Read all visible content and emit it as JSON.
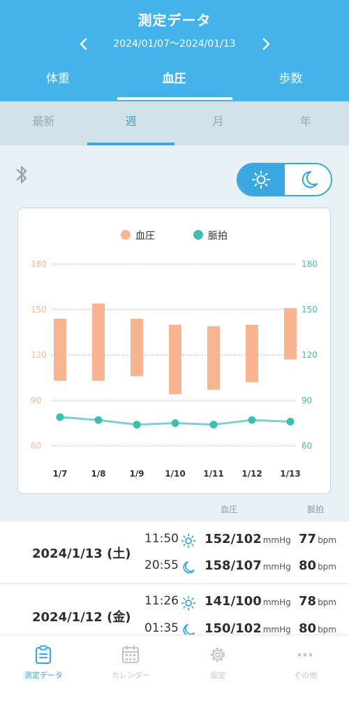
{
  "header": {
    "title": "測定データ",
    "date_range": "2024/01/07〜2024/01/13"
  },
  "tabs": [
    {
      "label": "体重"
    },
    {
      "label": "血圧"
    },
    {
      "label": "歩数"
    }
  ],
  "periods": [
    {
      "label": "最新"
    },
    {
      "label": "週"
    },
    {
      "label": "月"
    },
    {
      "label": "年"
    }
  ],
  "colors": {
    "accent": "#43b3e9",
    "bp": "#f9b592",
    "pulse": "#3fbdb0"
  },
  "chart_data": {
    "type": "bar",
    "categories": [
      "1/7",
      "1/8",
      "1/9",
      "1/10",
      "1/11",
      "1/12",
      "1/13"
    ],
    "series": [
      {
        "name": "血圧",
        "ranges": [
          [
            103,
            144
          ],
          [
            103,
            154
          ],
          [
            106,
            144
          ],
          [
            94,
            140
          ],
          [
            97,
            139
          ],
          [
            102,
            140
          ],
          [
            117,
            151
          ]
        ]
      },
      {
        "name": "脈拍",
        "type": "line",
        "values": [
          79,
          77,
          74,
          75,
          74,
          77,
          76
        ]
      }
    ],
    "yticks": [
      60,
      90,
      120,
      150,
      180
    ],
    "ylim": [
      60,
      180
    ],
    "legend": [
      "血圧",
      "脈拍"
    ],
    "legend_position": "top"
  },
  "list_labels": {
    "bp": "血圧",
    "pulse": "脈拍"
  },
  "records": [
    {
      "date": "2024/1/13 (土)",
      "entries": [
        {
          "time": "11:50",
          "icon": "sun-icon",
          "bp": "152/102",
          "bp_unit": "mmHg",
          "pulse": "77",
          "pulse_unit": "bpm"
        },
        {
          "time": "20:55",
          "icon": "moon-icon",
          "bp": "158/107",
          "bp_unit": "mmHg",
          "pulse": "80",
          "pulse_unit": "bpm"
        }
      ]
    },
    {
      "date": "2024/1/12 (金)",
      "entries": [
        {
          "time": "11:26",
          "icon": "sun-icon",
          "bp": "141/100",
          "bp_unit": "mmHg",
          "pulse": "78",
          "pulse_unit": "bpm"
        },
        {
          "time": "01:35",
          "icon": "moon-icon",
          "bp": "150/102",
          "bp_unit": "mmHg",
          "pulse": "80",
          "pulse_unit": "bpm"
        }
      ]
    }
  ],
  "nav": [
    {
      "label": "測定データ",
      "icon": "clipboard-icon"
    },
    {
      "label": "カレンダー",
      "icon": "calendar-icon"
    },
    {
      "label": "設定",
      "icon": "gear-icon"
    },
    {
      "label": "その他",
      "icon": "more-icon"
    }
  ]
}
